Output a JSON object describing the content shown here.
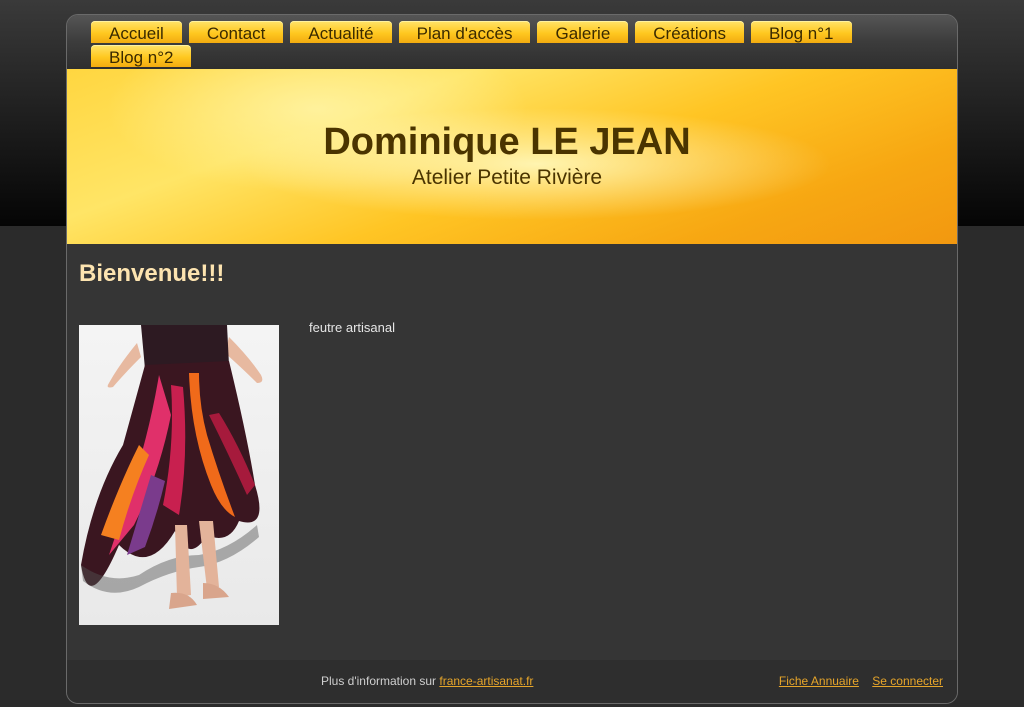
{
  "nav": {
    "items": [
      {
        "label": "Accueil"
      },
      {
        "label": "Contact"
      },
      {
        "label": "Actualité"
      },
      {
        "label": "Plan d'accès"
      },
      {
        "label": "Galerie"
      },
      {
        "label": "Créations"
      },
      {
        "label": "Blog n°1"
      },
      {
        "label": "Blog n°2"
      }
    ]
  },
  "banner": {
    "title": "Dominique LE JEAN",
    "subtitle": "Atelier Petite Rivière"
  },
  "main": {
    "heading": "Bienvenue!!!",
    "caption": "feutre artisanal"
  },
  "footer": {
    "info_text": "Plus d'information sur",
    "info_link": "france-artisanat.fr",
    "fiche_link": "Fiche Annuaire",
    "login_link": "Se connecter"
  },
  "colors": {
    "tab": "#ffc820",
    "heading": "#fde4b0",
    "link": "#e6a52a",
    "content_bg": "#353535"
  }
}
